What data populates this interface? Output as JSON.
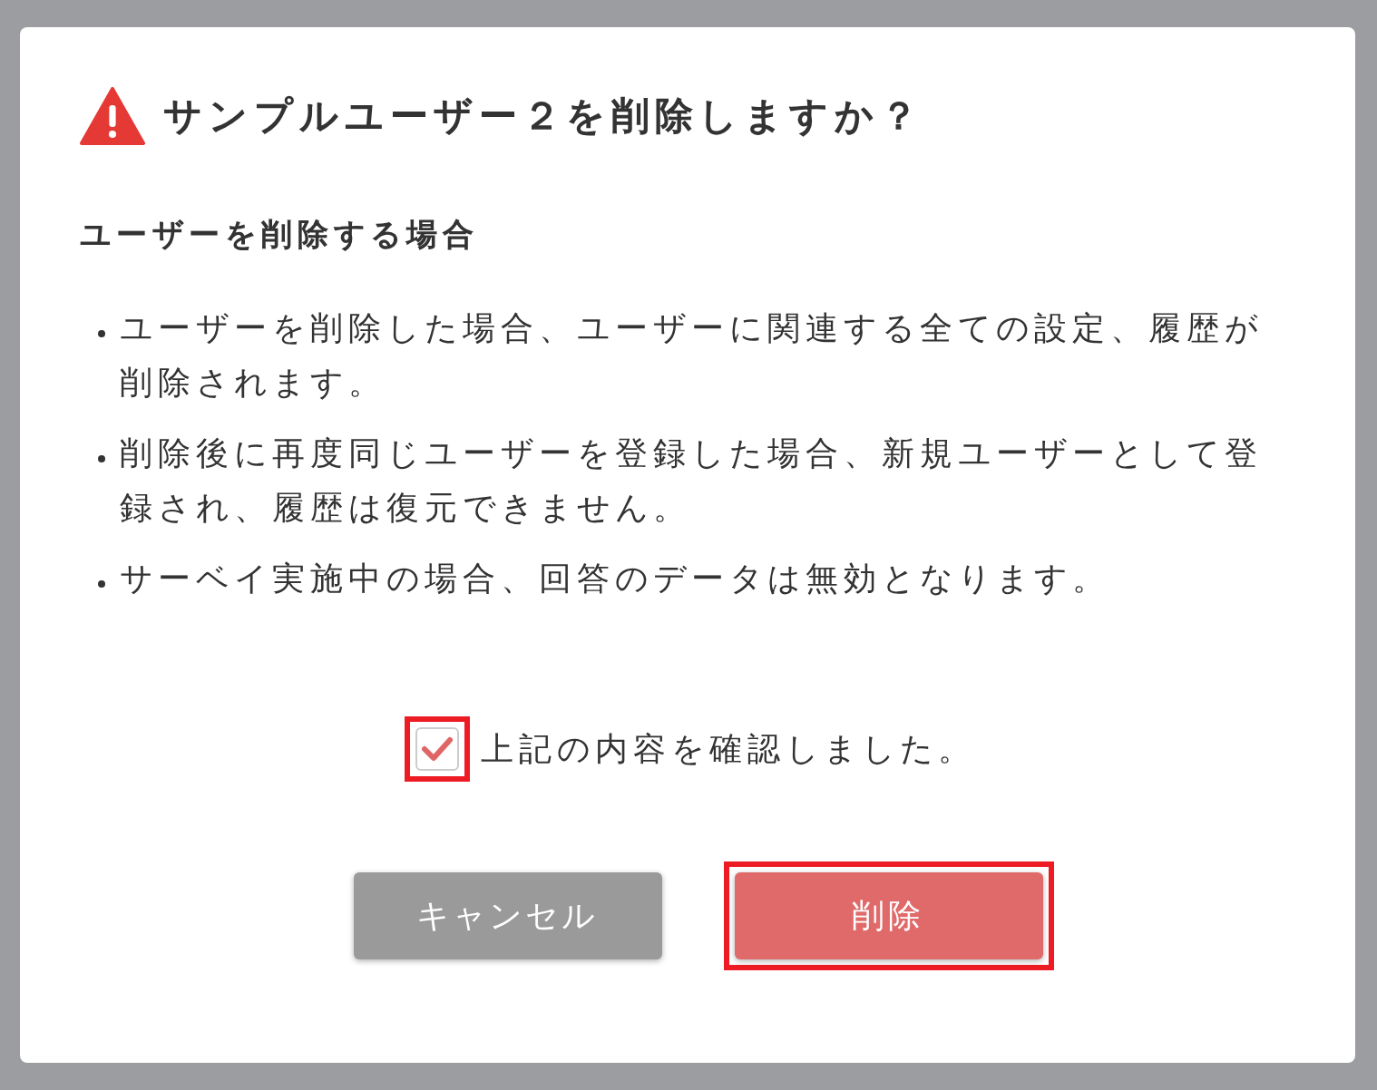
{
  "dialog": {
    "title": "サンプルユーザー２を削除しますか？",
    "section_heading": "ユーザーを削除する場合",
    "bullets": [
      "ユーザーを削除した場合、ユーザーに関連する全ての設定、履歴が削除されます。",
      "削除後に再度同じユーザーを登録した場合、新規ユーザーとして登録され、履歴は復元できません。",
      "サーベイ実施中の場合、回答のデータは無効となります。"
    ],
    "confirm": {
      "label": "上記の内容を確認しました。",
      "checked": true,
      "highlighted": true
    },
    "buttons": [
      {
        "label": "キャンセル",
        "kind": "cancel",
        "highlighted": false
      },
      {
        "label": "削除",
        "kind": "delete",
        "highlighted": true
      }
    ]
  }
}
